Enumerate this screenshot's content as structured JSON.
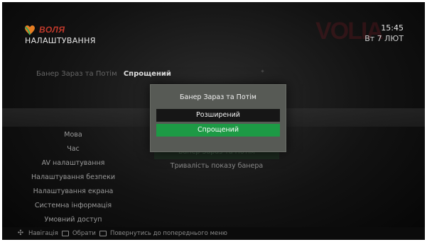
{
  "brand": {
    "logo_text": "ВОЛЯ",
    "logo_color": "#c0392b"
  },
  "header": {
    "title": "НАЛАШТУВАННЯ",
    "time": "15:45",
    "date": "Вт 7 ЛЮТ"
  },
  "current_setting": {
    "label": "Банер Зараз та Потім",
    "value": "Спрощений"
  },
  "side_menu": {
    "items": [
      {
        "label": "Мова"
      },
      {
        "label": "Час"
      },
      {
        "label": "AV налаштування"
      },
      {
        "label": "Налаштування безпеки"
      },
      {
        "label": "Налаштування екрана"
      },
      {
        "label": "Системна інформація"
      },
      {
        "label": "Умовний доступ"
      }
    ]
  },
  "submenu": {
    "items": [
      {
        "label": "Банер Зараз та Потім"
      },
      {
        "label": "Тривалість показу банера"
      }
    ]
  },
  "popup": {
    "title": "Банер Зараз та Потім",
    "options": [
      {
        "label": "Розширений",
        "selected": false
      },
      {
        "label": "Спрощений",
        "selected": true
      }
    ],
    "highlight_color": "#1d9a45"
  },
  "footer": {
    "nav_label": "Навігація",
    "ok_label": "Обрати",
    "back_label": "Повернутись до попереднього меню"
  }
}
